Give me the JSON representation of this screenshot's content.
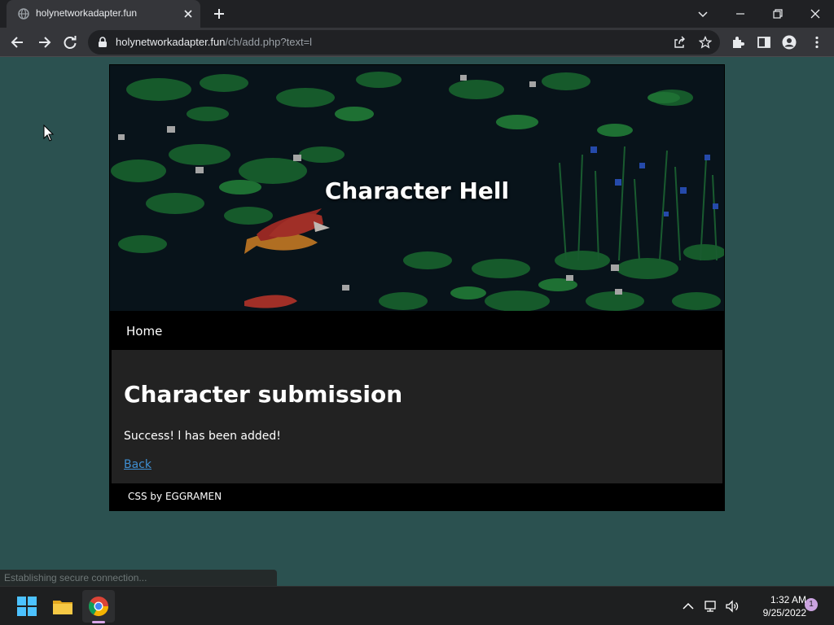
{
  "browser": {
    "tab_title": "holynetworkadapter.fun",
    "url_host": "holynetworkadapter.fun",
    "url_path": "/ch/add.php?text=l",
    "status_text": "Establishing secure connection..."
  },
  "page": {
    "site_title": "Character Hell",
    "nav_home": "Home",
    "heading": "Character submission",
    "message": "Success! l has been added!",
    "back_label": "Back",
    "footer_credit": "CSS by EGGRAMEN"
  },
  "taskbar": {
    "time": "1:32 AM",
    "date": "9/25/2022",
    "notification_count": "1"
  },
  "colors": {
    "page_background": "#2b5150",
    "content_background": "#222222",
    "link": "#3f8fd2",
    "browser_frame": "#202124"
  }
}
